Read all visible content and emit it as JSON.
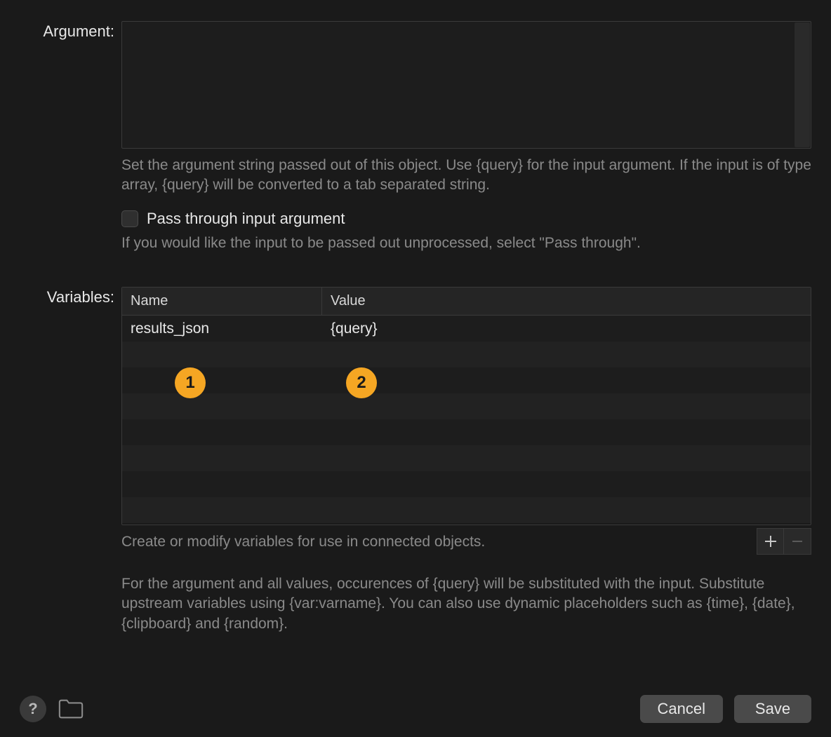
{
  "argument": {
    "label": "Argument:",
    "value": "",
    "help_text": "Set the argument string passed out of this object. Use {query} for the input argument. If the input is of type array, {query} will be converted to a tab separated string.",
    "passthrough_label": "Pass through input argument",
    "passthrough_help": "If you would like the input to be passed out unprocessed, select \"Pass through\"."
  },
  "variables": {
    "label": "Variables:",
    "columns": {
      "name": "Name",
      "value": "Value"
    },
    "rows": [
      {
        "name": "results_json",
        "value": "{query}"
      }
    ],
    "help_text": "Create or modify variables for use in connected objects.",
    "substitute_text": "For the argument and all values, occurences of {query} will be substituted with the input. Substitute upstream variables using {var:varname}. You can also use dynamic placeholders such as {time}, {date}, {clipboard} and {random}."
  },
  "buttons": {
    "cancel": "Cancel",
    "save": "Save"
  },
  "annotations": {
    "badge1": "1",
    "badge2": "2"
  }
}
